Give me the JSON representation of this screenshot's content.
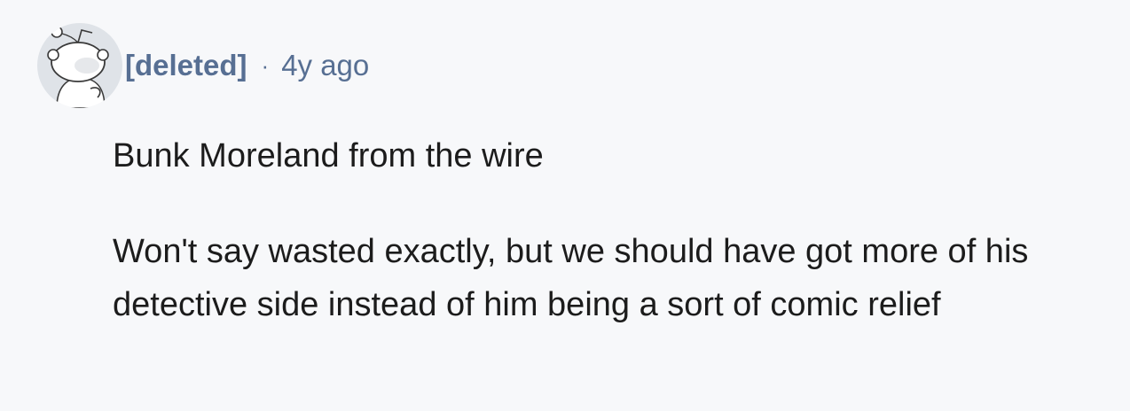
{
  "comment": {
    "author": "[deleted]",
    "separator": "·",
    "age": "4y ago",
    "paragraphs": [
      "Bunk Moreland from the wire",
      "Won't say wasted exactly, but we should have got more of his detective side instead of him being a sort of comic relief"
    ]
  },
  "icons": {
    "avatar": "default-snoo-avatar-icon"
  },
  "colors": {
    "background": "#f7f8fa",
    "username": "#576f93",
    "body_text": "#1c1c1c"
  }
}
